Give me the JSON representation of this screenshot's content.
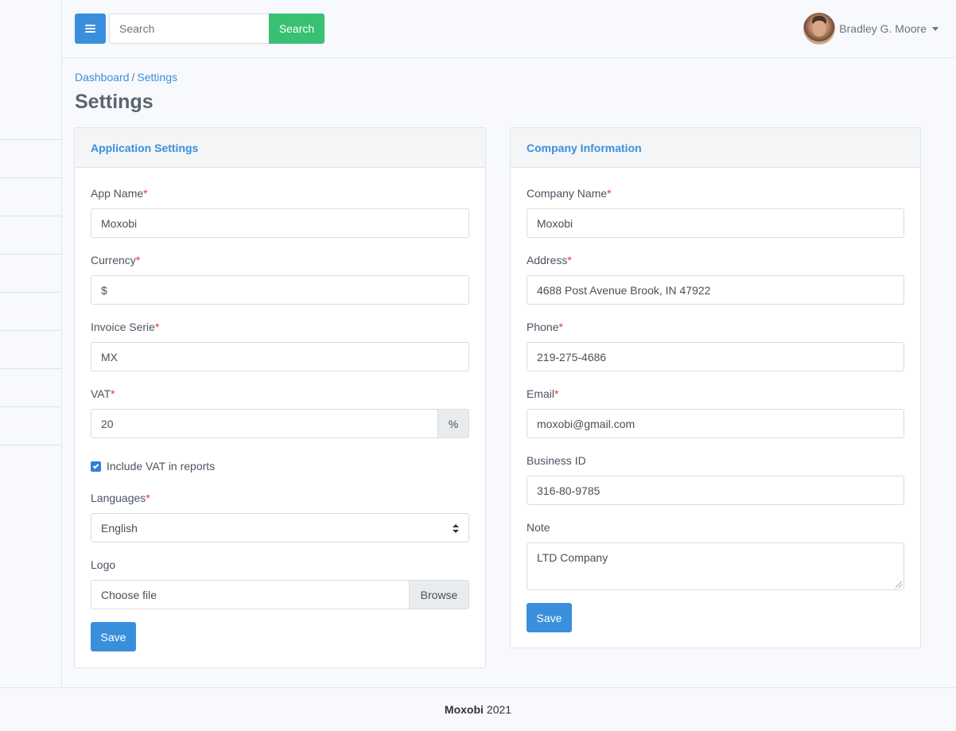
{
  "header": {
    "search": {
      "placeholder": "Search",
      "button_label": "Search"
    },
    "user": {
      "name": "Bradley G. Moore"
    }
  },
  "breadcrumb": {
    "items": [
      "Dashboard",
      "Settings"
    ],
    "separator": "/"
  },
  "page": {
    "title": "Settings"
  },
  "app_settings": {
    "title": "Application Settings",
    "app_name": {
      "label": "App Name",
      "value": "Moxobi"
    },
    "currency": {
      "label": "Currency",
      "value": "$"
    },
    "invoice_serie": {
      "label": "Invoice Serie",
      "value": "MX"
    },
    "vat": {
      "label": "VAT",
      "value": "20",
      "suffix": "%"
    },
    "include_vat": {
      "label": "Include VAT in reports",
      "checked": true
    },
    "languages": {
      "label": "Languages",
      "value": "English"
    },
    "logo": {
      "label": "Logo",
      "placeholder": "Choose file",
      "browse_label": "Browse"
    },
    "save_label": "Save"
  },
  "company_info": {
    "title": "Company Information",
    "company_name": {
      "label": "Company Name",
      "value": "Moxobi"
    },
    "address": {
      "label": "Address",
      "value": "4688 Post Avenue Brook, IN 47922"
    },
    "phone": {
      "label": "Phone",
      "value": "219-275-4686"
    },
    "email": {
      "label": "Email",
      "value": "moxobi@gmail.com"
    },
    "business_id": {
      "label": "Business ID",
      "value": "316-80-9785"
    },
    "note": {
      "label": "Note",
      "value": "LTD Company"
    },
    "save_label": "Save"
  },
  "required_marker": "*",
  "footer": {
    "brand": "Moxobi",
    "year": "2021"
  },
  "colors": {
    "primary": "#3a8fdd",
    "success": "#38c172",
    "required": "#e3342f",
    "background": "#f7f9fc"
  }
}
